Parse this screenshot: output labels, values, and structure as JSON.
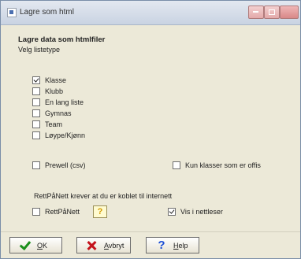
{
  "window": {
    "title": "Lagre som html"
  },
  "form": {
    "heading": "Lagre data som htmlfiler",
    "subheading": "Velg listetype"
  },
  "list_types": [
    {
      "label": "Klasse",
      "checked": true
    },
    {
      "label": "Klubb",
      "checked": false
    },
    {
      "label": "En lang liste",
      "checked": false
    },
    {
      "label": "Gymnas",
      "checked": false
    },
    {
      "label": "Team",
      "checked": false
    },
    {
      "label": "Løype/Kjønn",
      "checked": false
    }
  ],
  "options": {
    "prewell_label": "Prewell (csv)",
    "prewell_checked": false,
    "only_classes_label": "Kun klasser som er offis",
    "only_classes_checked": false
  },
  "internet": {
    "info": "RettPåNett krever at du er koblet til internett",
    "rettpanett_label": "RettPåNett",
    "rettpanett_checked": false,
    "help_icon": "?",
    "show_in_browser_label": "Vis i nettleser",
    "show_in_browser_checked": true
  },
  "buttons": {
    "ok_mnemonic": "O",
    "ok_rest": "K",
    "cancel_mnemonic": "A",
    "cancel_rest": "vbryt",
    "help_mnemonic": "H",
    "help_rest": "elp"
  },
  "icons": {
    "ok": "checkmark-icon",
    "cancel": "x-icon",
    "help": "question-mark-icon"
  }
}
